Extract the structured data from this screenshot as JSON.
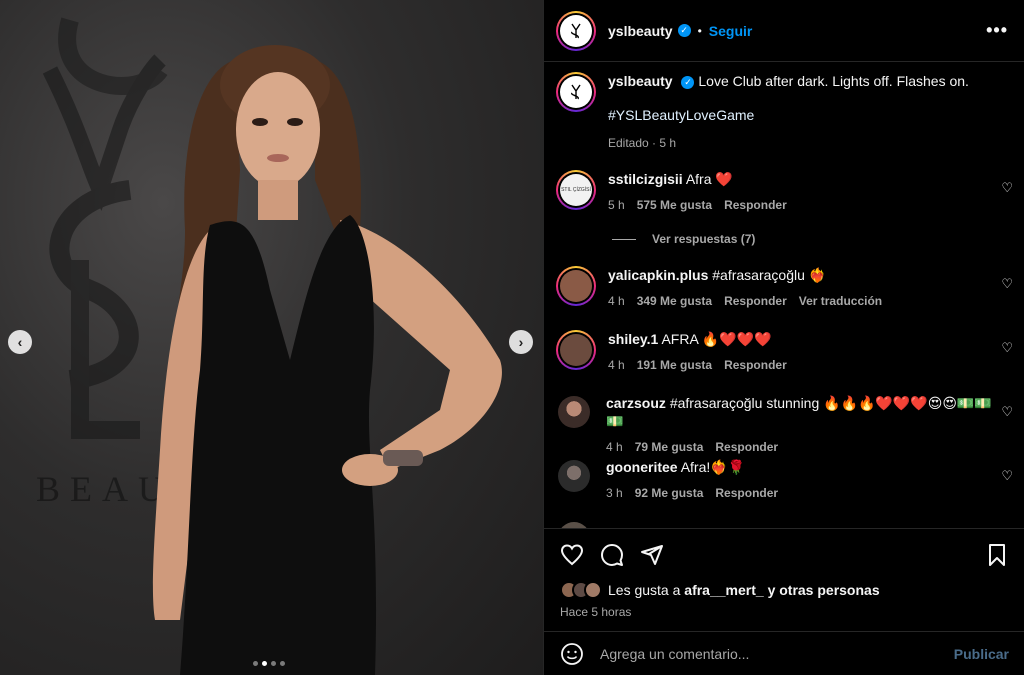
{
  "photo": {
    "brand_watermark": "BEAUT",
    "carousel_total": 4,
    "carousel_active": 2
  },
  "header": {
    "username": "yslbeauty",
    "separator": "•",
    "follow_label": "Seguir",
    "more_icon": "more-horizontal-icon"
  },
  "caption": {
    "username": "yslbeauty",
    "text": "Love Club after dark. Lights off. Flashes on.",
    "hashtag": "#YSLBeautyLoveGame",
    "meta": "Editado · 5 h"
  },
  "comments": [
    {
      "username": "sstilcizgisii",
      "text": "Afra ❤️",
      "time": "5 h",
      "likes": "575 Me gusta",
      "reply": "Responder",
      "extra": ""
    },
    {
      "username": "yalicapkin.plus",
      "text": "#afrasaraçoğlu ❤️‍🔥",
      "time": "4 h",
      "likes": "349 Me gusta",
      "reply": "Responder",
      "extra": "Ver traducción"
    },
    {
      "username": "shiley.1",
      "text": "AFRA 🔥❤️❤️❤️",
      "time": "4 h",
      "likes": "191 Me gusta",
      "reply": "Responder",
      "extra": ""
    },
    {
      "username": "carzsouz",
      "text": "#afrasaraçoğlu stunning 🔥🔥🔥❤️❤️❤️😍😍💵💵💵",
      "time": "4 h",
      "likes": "79 Me gusta",
      "reply": "Responder",
      "extra": ""
    },
    {
      "username": "gooneritee",
      "text": "Afra!❤️‍🔥🌹",
      "time": "3 h",
      "likes": "92 Me gusta",
      "reply": "Responder",
      "extra": ""
    }
  ],
  "view_replies": "Ver respuestas (7)",
  "likes": {
    "prefix": "Les gusta a",
    "user": "afra__mert_",
    "suffix": "y otras personas",
    "time_ago": "Hace 5 horas"
  },
  "add_comment": {
    "placeholder": "Agrega un comentario...",
    "publish_label": "Publicar"
  },
  "colors": {
    "accent": "#0095f6",
    "background": "#000000",
    "muted": "#a8a8a8",
    "publish_disabled": "#4a6c8a"
  }
}
